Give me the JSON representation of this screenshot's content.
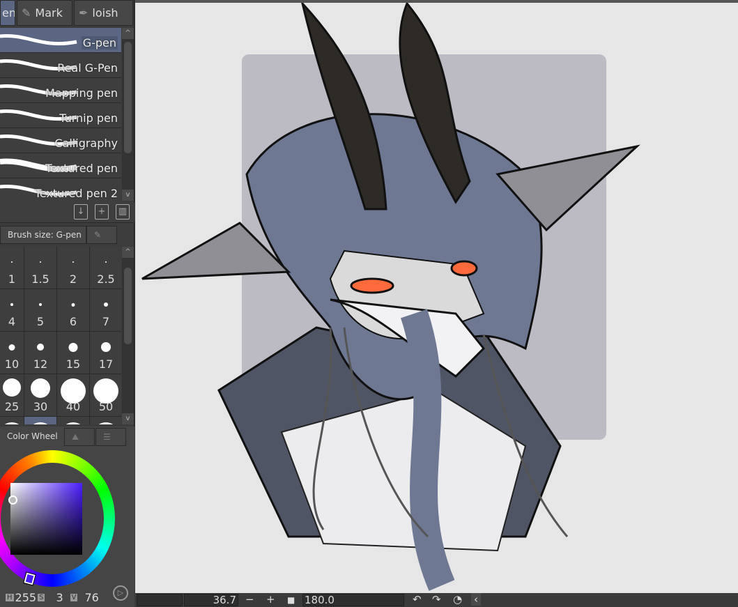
{
  "tool_tabs": [
    {
      "label": "en",
      "icon": "pen-icon"
    },
    {
      "label": "Mark",
      "icon": "marker-icon"
    },
    {
      "label": "loish",
      "icon": "brush-icon"
    }
  ],
  "brushes": [
    {
      "label": "G-pen",
      "selected": true
    },
    {
      "label": "Real G-Pen"
    },
    {
      "label": "Mapping pen"
    },
    {
      "label": "Turnip pen"
    },
    {
      "label": "Calligraphy"
    },
    {
      "label": "Textured pen"
    },
    {
      "label": "Textured pen 2"
    }
  ],
  "brush_size": {
    "title": "Brush size: G-pen",
    "sizes": [
      "1",
      "1.5",
      "2",
      "2.5",
      "4",
      "5",
      "6",
      "7",
      "10",
      "12",
      "15",
      "17",
      "25",
      "30",
      "40",
      "50",
      "",
      "",
      "",
      ""
    ],
    "selected_index": 17
  },
  "color": {
    "tab_label": "Color Wheel",
    "h_label": "H",
    "h": "255",
    "s_label": "S",
    "s": "3",
    "v_label": "V",
    "v": "76",
    "accent": "#4b1eff"
  },
  "status": {
    "zoom": "36.7",
    "rotation": "180.0"
  }
}
